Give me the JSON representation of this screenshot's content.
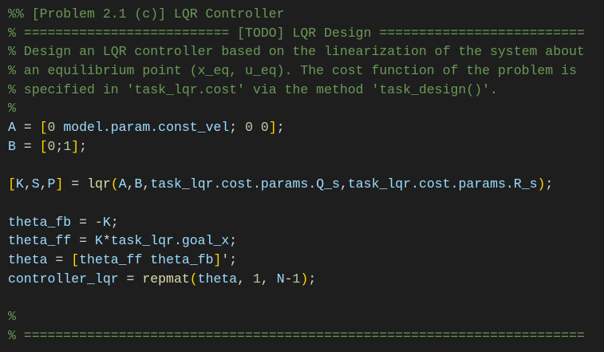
{
  "editor": {
    "lines": [
      [
        [
          "comment",
          "%% [Problem 2.1 (c)] LQR Controller"
        ]
      ],
      [
        [
          "comment",
          "% ========================== [TODO] LQR Design =========================="
        ]
      ],
      [
        [
          "comment",
          "% Design an LQR controller based on the linearization of the system about"
        ]
      ],
      [
        [
          "comment",
          "% an equilibrium point (x_eq, u_eq). The cost function of the problem is"
        ]
      ],
      [
        [
          "comment",
          "% specified in 'task_lqr.cost' via the method 'task_design()'."
        ]
      ],
      [
        [
          "comment",
          "%"
        ]
      ],
      [
        [
          "var",
          "A"
        ],
        [
          "op",
          " = "
        ],
        [
          "br",
          "["
        ],
        [
          "num",
          "0"
        ],
        [
          "op",
          " "
        ],
        [
          "var",
          "model.param.const_vel"
        ],
        [
          "op",
          "; "
        ],
        [
          "num",
          "0"
        ],
        [
          "op",
          " "
        ],
        [
          "num",
          "0"
        ],
        [
          "br",
          "]"
        ],
        [
          "op",
          ";"
        ]
      ],
      [
        [
          "var",
          "B"
        ],
        [
          "op",
          " = "
        ],
        [
          "br",
          "["
        ],
        [
          "num",
          "0"
        ],
        [
          "op",
          ";"
        ],
        [
          "num",
          "1"
        ],
        [
          "br",
          "]"
        ],
        [
          "op",
          ";"
        ]
      ],
      [],
      [
        [
          "br",
          "["
        ],
        [
          "var",
          "K"
        ],
        [
          "op",
          ","
        ],
        [
          "var",
          "S"
        ],
        [
          "op",
          ","
        ],
        [
          "var",
          "P"
        ],
        [
          "br",
          "]"
        ],
        [
          "op",
          " = "
        ],
        [
          "fn",
          "lqr"
        ],
        [
          "br",
          "("
        ],
        [
          "var",
          "A"
        ],
        [
          "op",
          ","
        ],
        [
          "var",
          "B"
        ],
        [
          "op",
          ","
        ],
        [
          "var",
          "task_lqr.cost.params.Q_s"
        ],
        [
          "op",
          ","
        ],
        [
          "var",
          "task_lqr.cost.params.R_s"
        ],
        [
          "br",
          ")"
        ],
        [
          "op",
          ";"
        ]
      ],
      [],
      [
        [
          "var",
          "theta_fb"
        ],
        [
          "op",
          " = -"
        ],
        [
          "var",
          "K"
        ],
        [
          "op",
          ";"
        ]
      ],
      [
        [
          "var",
          "theta_ff"
        ],
        [
          "op",
          " = "
        ],
        [
          "var",
          "K"
        ],
        [
          "op",
          "*"
        ],
        [
          "var",
          "task_lqr.goal_x"
        ],
        [
          "op",
          ";"
        ]
      ],
      [
        [
          "var",
          "theta"
        ],
        [
          "op",
          " = "
        ],
        [
          "br",
          "["
        ],
        [
          "var",
          "theta_ff"
        ],
        [
          "op",
          " "
        ],
        [
          "var",
          "theta_fb"
        ],
        [
          "br",
          "]"
        ],
        [
          "op",
          "';"
        ]
      ],
      [
        [
          "var",
          "controller_lqr"
        ],
        [
          "op",
          " = "
        ],
        [
          "fn",
          "repmat"
        ],
        [
          "br",
          "("
        ],
        [
          "var",
          "theta"
        ],
        [
          "op",
          ", "
        ],
        [
          "num",
          "1"
        ],
        [
          "op",
          ", "
        ],
        [
          "var",
          "N"
        ],
        [
          "op",
          "-"
        ],
        [
          "num",
          "1"
        ],
        [
          "br",
          ")"
        ],
        [
          "op",
          ";"
        ]
      ],
      [],
      [
        [
          "comment",
          "%"
        ]
      ],
      [
        [
          "comment",
          "% ======================================================================="
        ]
      ]
    ]
  }
}
